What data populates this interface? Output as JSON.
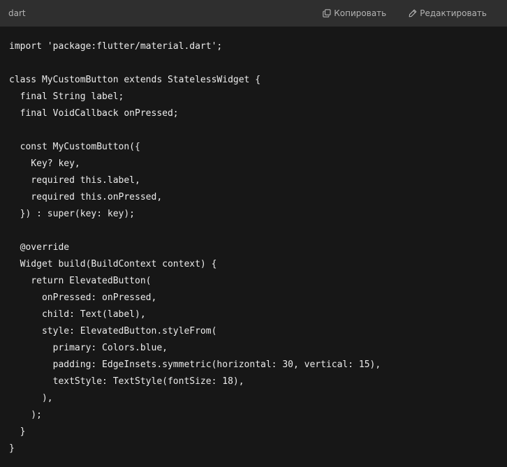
{
  "header": {
    "language": "dart",
    "copy_label": "Копировать",
    "copy_icon": "copy-icon",
    "edit_label": "Редактировать",
    "edit_icon": "pencil-icon"
  },
  "code": {
    "lines": [
      "import 'package:flutter/material.dart';",
      "",
      "class MyCustomButton extends StatelessWidget {",
      "  final String label;",
      "  final VoidCallback onPressed;",
      "",
      "  const MyCustomButton({",
      "    Key? key,",
      "    required this.label,",
      "    required this.onPressed,",
      "  }) : super(key: key);",
      "",
      "  @override",
      "  Widget build(BuildContext context) {",
      "    return ElevatedButton(",
      "      onPressed: onPressed,",
      "      child: Text(label),",
      "      style: ElevatedButton.styleFrom(",
      "        primary: Colors.blue,",
      "        padding: EdgeInsets.symmetric(horizontal: 30, vertical: 15),",
      "        textStyle: TextStyle(fontSize: 18),",
      "      ),",
      "    );",
      "  }",
      "}"
    ]
  }
}
